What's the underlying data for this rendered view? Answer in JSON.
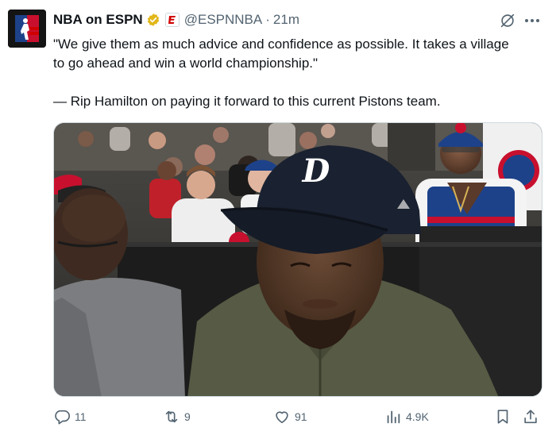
{
  "tweet": {
    "author_name": "NBA on ESPN",
    "handle": "@ESPNNBA",
    "separator": "·",
    "time": "21m",
    "text_line1": "\"We give them as much advice and confidence as possible. It takes a village",
    "text_line2": "to go ahead and win a world championship.\"",
    "text_line3": "— Rip Hamilton on paying it forward to this current Pistons team."
  },
  "icons": {
    "avatar": "nba-espn-logo",
    "verified": "gold-verified-badge-icon",
    "affiliate": "espn-affiliate-badge-icon",
    "grok": "grok-icon",
    "more": "more-options-icon",
    "reply": "reply-icon",
    "retweet": "retweet-icon",
    "like": "like-icon",
    "views": "views-icon",
    "bookmark": "bookmark-icon",
    "share": "share-icon"
  },
  "stats": {
    "replies": "11",
    "retweets": "9",
    "likes": "91",
    "views": "4.9K"
  },
  "colors": {
    "text": "#0f1419",
    "secondary": "#536471",
    "verified_gold": "#e2b719",
    "espn_red": "#d00000"
  }
}
